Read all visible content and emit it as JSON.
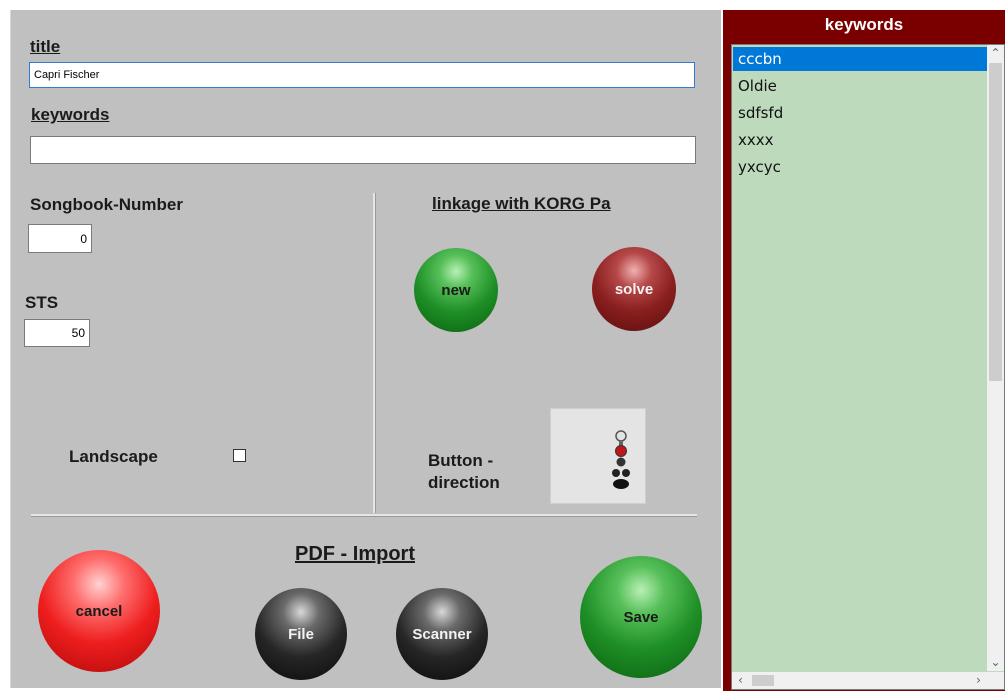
{
  "form": {
    "title_label": "title",
    "title_value": "Capri Fischer",
    "keywords_label": "keywords",
    "keywords_value": "",
    "songbook_label": "Songbook-Number",
    "songbook_value": "0",
    "sts_label": "STS",
    "sts_value": "50",
    "landscape_label": "Landscape",
    "landscape_checked": false
  },
  "korg": {
    "heading": "linkage with KORG Pa",
    "new_label": "new",
    "solve_label": "solve",
    "direction_label": "Button - direction"
  },
  "pdf": {
    "heading": "PDF - Import",
    "file_label": "File",
    "scanner_label": "Scanner"
  },
  "actions": {
    "cancel_label": "cancel",
    "save_label": "Save"
  },
  "keywords_panel": {
    "header": "keywords",
    "items": [
      {
        "label": "cccbn",
        "selected": true
      },
      {
        "label": "Oldie",
        "selected": false
      },
      {
        "label": "sdfsfd",
        "selected": false
      },
      {
        "label": "xxxx",
        "selected": false
      },
      {
        "label": "yxcyc",
        "selected": false
      }
    ]
  },
  "colors": {
    "panel_bg": "#c0c0c0",
    "sidebar_bg": "#7a0000",
    "list_bg": "#bddabd",
    "selection": "#0078d7"
  }
}
